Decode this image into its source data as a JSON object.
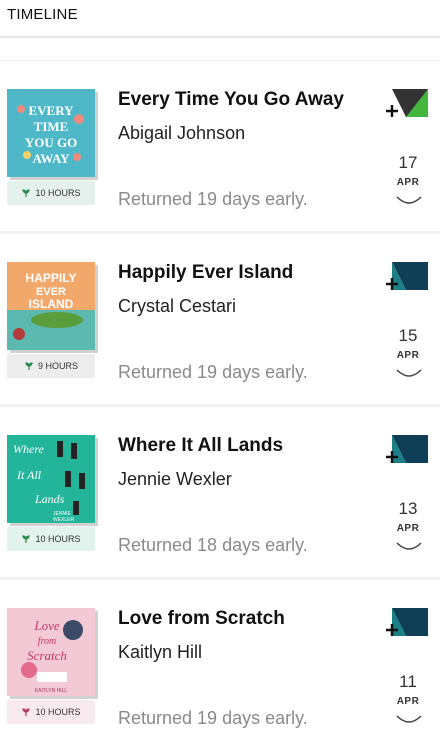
{
  "header": {
    "title": "TIMELINE"
  },
  "items": [
    {
      "title": "Every Time You Go Away",
      "author": "Abigail Johnson",
      "duration": "10 HOURS",
      "status": "Returned 19 days early.",
      "day": "17",
      "month": "APR",
      "cover_text": [
        "EVERY",
        "TIME",
        "YOU GO",
        "AWAY"
      ],
      "cover_color": "#4fb8c8",
      "duration_bg": "#e4f1ec",
      "icon": "shelf-add-icon"
    },
    {
      "title": "Happily Ever Island",
      "author": "Crystal Cestari",
      "duration": "9 HOURS",
      "status": "Returned 19 days early.",
      "day": "15",
      "month": "APR",
      "cover_text": [
        "HAPPILY",
        "EVER",
        "ISLAND"
      ],
      "cover_color": "#f2a86a",
      "duration_bg": "#ededed",
      "icon": "shelf-add-icon"
    },
    {
      "title": "Where It All Lands",
      "author": "Jennie Wexler",
      "duration": "10 HOURS",
      "status": "Returned 18 days early.",
      "day": "13",
      "month": "APR",
      "cover_text": [
        "Where",
        "It All",
        "Lands",
        "JENNIE",
        "WEXLER"
      ],
      "cover_color": "#23b59a",
      "duration_bg": "#e1f3ec",
      "icon": "shelf-add-icon"
    },
    {
      "title": "Love from Scratch",
      "author": "Kaitlyn Hill",
      "duration": "10 HOURS",
      "status": "Returned 19 days early.",
      "day": "11",
      "month": "APR",
      "cover_text": [
        "Love",
        "from",
        "Scratch",
        "KAITLYN HILL"
      ],
      "cover_color": "#f3c9d6",
      "duration_bg": "#f8e9ef",
      "icon": "shelf-add-icon"
    }
  ]
}
